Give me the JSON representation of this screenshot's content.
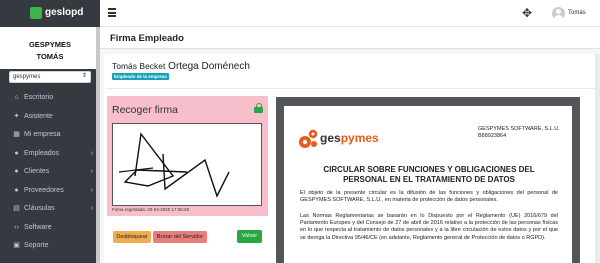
{
  "app": {
    "brand": "geslopd"
  },
  "topbar": {
    "user_name": "Tomás"
  },
  "sidebar": {
    "company": "GESPYMES",
    "user": "TOMÁS",
    "select_value": "gespymes",
    "items": [
      {
        "label": "Escritorio",
        "icon": "dashboard-icon",
        "chevron": false
      },
      {
        "label": "Asistente",
        "icon": "magic-wand-icon",
        "chevron": false
      },
      {
        "label": "Mi empresa",
        "icon": "building-icon",
        "chevron": false
      },
      {
        "label": "Empleados",
        "icon": "users-icon",
        "chevron": true
      },
      {
        "label": "Clientes",
        "icon": "users-icon",
        "chevron": true
      },
      {
        "label": "Proveedores",
        "icon": "users-icon",
        "chevron": true
      },
      {
        "label": "Cláusulas",
        "icon": "file-icon",
        "chevron": true
      },
      {
        "label": "Software",
        "icon": "code-icon",
        "chevron": false
      },
      {
        "label": "Soporte",
        "icon": "support-icon",
        "chevron": false
      }
    ]
  },
  "page": {
    "title": "Firma Empleado",
    "employee_first": "Tomás Becket",
    "employee_last": "Ortega Doménech",
    "badge": "Empleado de la empresa"
  },
  "signature": {
    "title": "Recoger firma",
    "date_label": "Firma registrada: 20-04-2020 17:06:28",
    "buttons": {
      "unlock": "Desbloquear",
      "clear": "Borrar del Servidor",
      "back": "Volver"
    }
  },
  "pdf": {
    "logo_prefix": "ges",
    "logo_suffix": "pymes",
    "company_line1": "GESPYMES SOFTWARE, S.L.U.",
    "company_line2": "B88923864",
    "heading_line1": "CIRCULAR SOBRE FUNCIONES Y OBLIGACIONES DEL",
    "heading_line2": "PERSONAL EN EL TRATAMIENTO DE DATOS",
    "paragraph1": "El objeto de la presente circular es la difusión de las funciones y obligaciones del personal de GESPYMES SOFTWARE, S.L.U., en materia de protección de datos personales.",
    "paragraph2": "Las Normas Reglamentarias se basarán en lo Dispuesto por el Reglamento (UE) 2016/679 del Parlamento Europeo y del Consejo de 27 de abril de 2016 relativo a la protección de las personas físicas en lo que respecta al tratamiento de datos personales y a la libre circulación de estos datos y por el que se deroga la Directiva 95/46/CE (en adelante, Reglamento general de Protección de datos o RGPD)."
  },
  "colors": {
    "sidebar": "#343a40",
    "brand_green": "#39b54a",
    "sign_bg": "#f6bfcb",
    "badge": "#17a2b8",
    "gear_orange": "#e85a1a"
  }
}
